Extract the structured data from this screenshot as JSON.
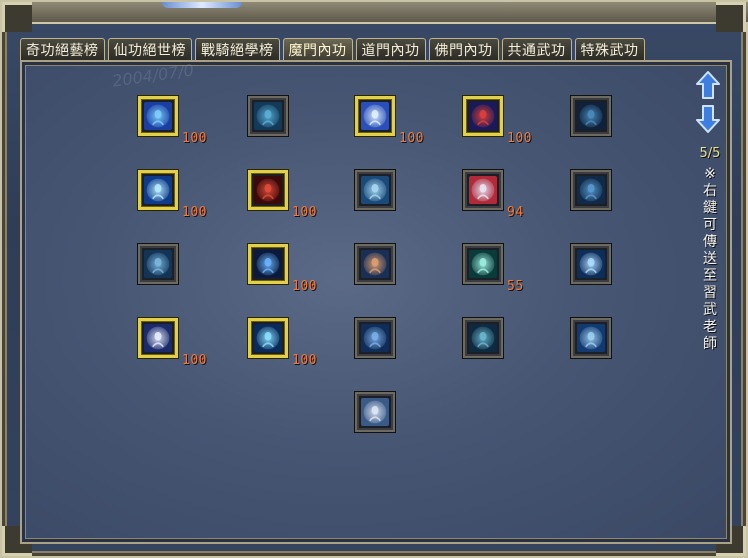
{
  "tabs": [
    {
      "label": "奇功絕藝榜",
      "active": false
    },
    {
      "label": "仙功絕世榜",
      "active": false
    },
    {
      "label": "戰騎絕學榜",
      "active": false
    },
    {
      "label": "魔門內功",
      "active": true
    },
    {
      "label": "道門內功",
      "active": false
    },
    {
      "label": "佛門內功",
      "active": false
    },
    {
      "label": "共通武功",
      "active": false
    },
    {
      "label": "特殊武功",
      "active": false
    }
  ],
  "skills": [
    {
      "icon": "water-vortex-skill-icon",
      "level": "100",
      "learned": true,
      "colors": [
        "#1a3fa0",
        "#7fd0ff"
      ]
    },
    {
      "icon": "meditating-figure-skill-icon",
      "level": "",
      "learned": false,
      "colors": [
        "#143a5a",
        "#5ab0d8"
      ]
    },
    {
      "icon": "winged-spirit-skill-icon",
      "level": "100",
      "learned": true,
      "colors": [
        "#2a4fb8",
        "#e0f2ff"
      ]
    },
    {
      "icon": "crimson-slash-skill-icon",
      "level": "100",
      "learned": true,
      "colors": [
        "#1a1a5a",
        "#e0403a"
      ]
    },
    {
      "icon": "dark-warrior-skill-icon",
      "level": "",
      "learned": false,
      "colors": [
        "#10223a",
        "#4a8cc0"
      ]
    },
    {
      "icon": "wind-spiral-skill-icon",
      "level": "100",
      "learned": true,
      "colors": [
        "#0e3a8a",
        "#b8ecff"
      ]
    },
    {
      "icon": "blood-armor-skill-icon",
      "level": "100",
      "learned": true,
      "colors": [
        "#3a0a0a",
        "#e24c3a"
      ]
    },
    {
      "icon": "ice-wave-skill-icon",
      "level": "",
      "learned": false,
      "colors": [
        "#1a4a7a",
        "#a8d8f0"
      ]
    },
    {
      "icon": "yin-yang-skill-icon",
      "level": "94",
      "learned": false,
      "colors": [
        "#b02a3a",
        "#e8e8f8"
      ]
    },
    {
      "icon": "standing-figure-skill-icon",
      "level": "",
      "learned": false,
      "colors": [
        "#102a48",
        "#5a9ad0"
      ]
    },
    {
      "icon": "tree-root-skill-icon",
      "level": "",
      "learned": false,
      "colors": [
        "#123456",
        "#7ab8e0"
      ]
    },
    {
      "icon": "armored-knight-skill-icon",
      "level": "100",
      "learned": true,
      "colors": [
        "#0a1a3a",
        "#6ab4ff"
      ]
    },
    {
      "icon": "flame-monk-skill-icon",
      "level": "",
      "learned": false,
      "colors": [
        "#1a2f55",
        "#e0a070"
      ]
    },
    {
      "icon": "spirit-totem-skill-icon",
      "level": "55",
      "learned": false,
      "colors": [
        "#0a3a3a",
        "#9ef0e0"
      ]
    },
    {
      "icon": "moon-orb-skill-icon",
      "level": "",
      "learned": false,
      "colors": [
        "#0e2e5a",
        "#b0dcff"
      ]
    },
    {
      "icon": "crescent-blade-skill-icon",
      "level": "100",
      "learned": true,
      "colors": [
        "#1a2a6a",
        "#e8eeff"
      ]
    },
    {
      "icon": "glowing-body-skill-icon",
      "level": "100",
      "learned": true,
      "colors": [
        "#0a2a5a",
        "#8ae0ff"
      ]
    },
    {
      "icon": "energy-ring-skill-icon",
      "level": "",
      "learned": false,
      "colors": [
        "#102c58",
        "#7ab0e8"
      ]
    },
    {
      "icon": "twin-spirits-skill-icon",
      "level": "",
      "learned": false,
      "colors": [
        "#0e2a40",
        "#6ab8d0"
      ]
    },
    {
      "icon": "sweeping-wave-skill-icon",
      "level": "",
      "learned": false,
      "colors": [
        "#123a70",
        "#a0d0f0"
      ]
    },
    {
      "icon": "mist-cloud-skill-icon",
      "level": "",
      "learned": false,
      "colors": [
        "#3a5a88",
        "#dfe8f5"
      ]
    }
  ],
  "page_indicator": "5/5",
  "hint_text": "※右鍵可傳送至習武老師",
  "watermark": "2004/07/0",
  "colors": {
    "level_text": "#f07a3a",
    "learned_border": "#e2d04a",
    "page_indicator": "#e6e08a",
    "arrow": "#5b9cf0"
  }
}
